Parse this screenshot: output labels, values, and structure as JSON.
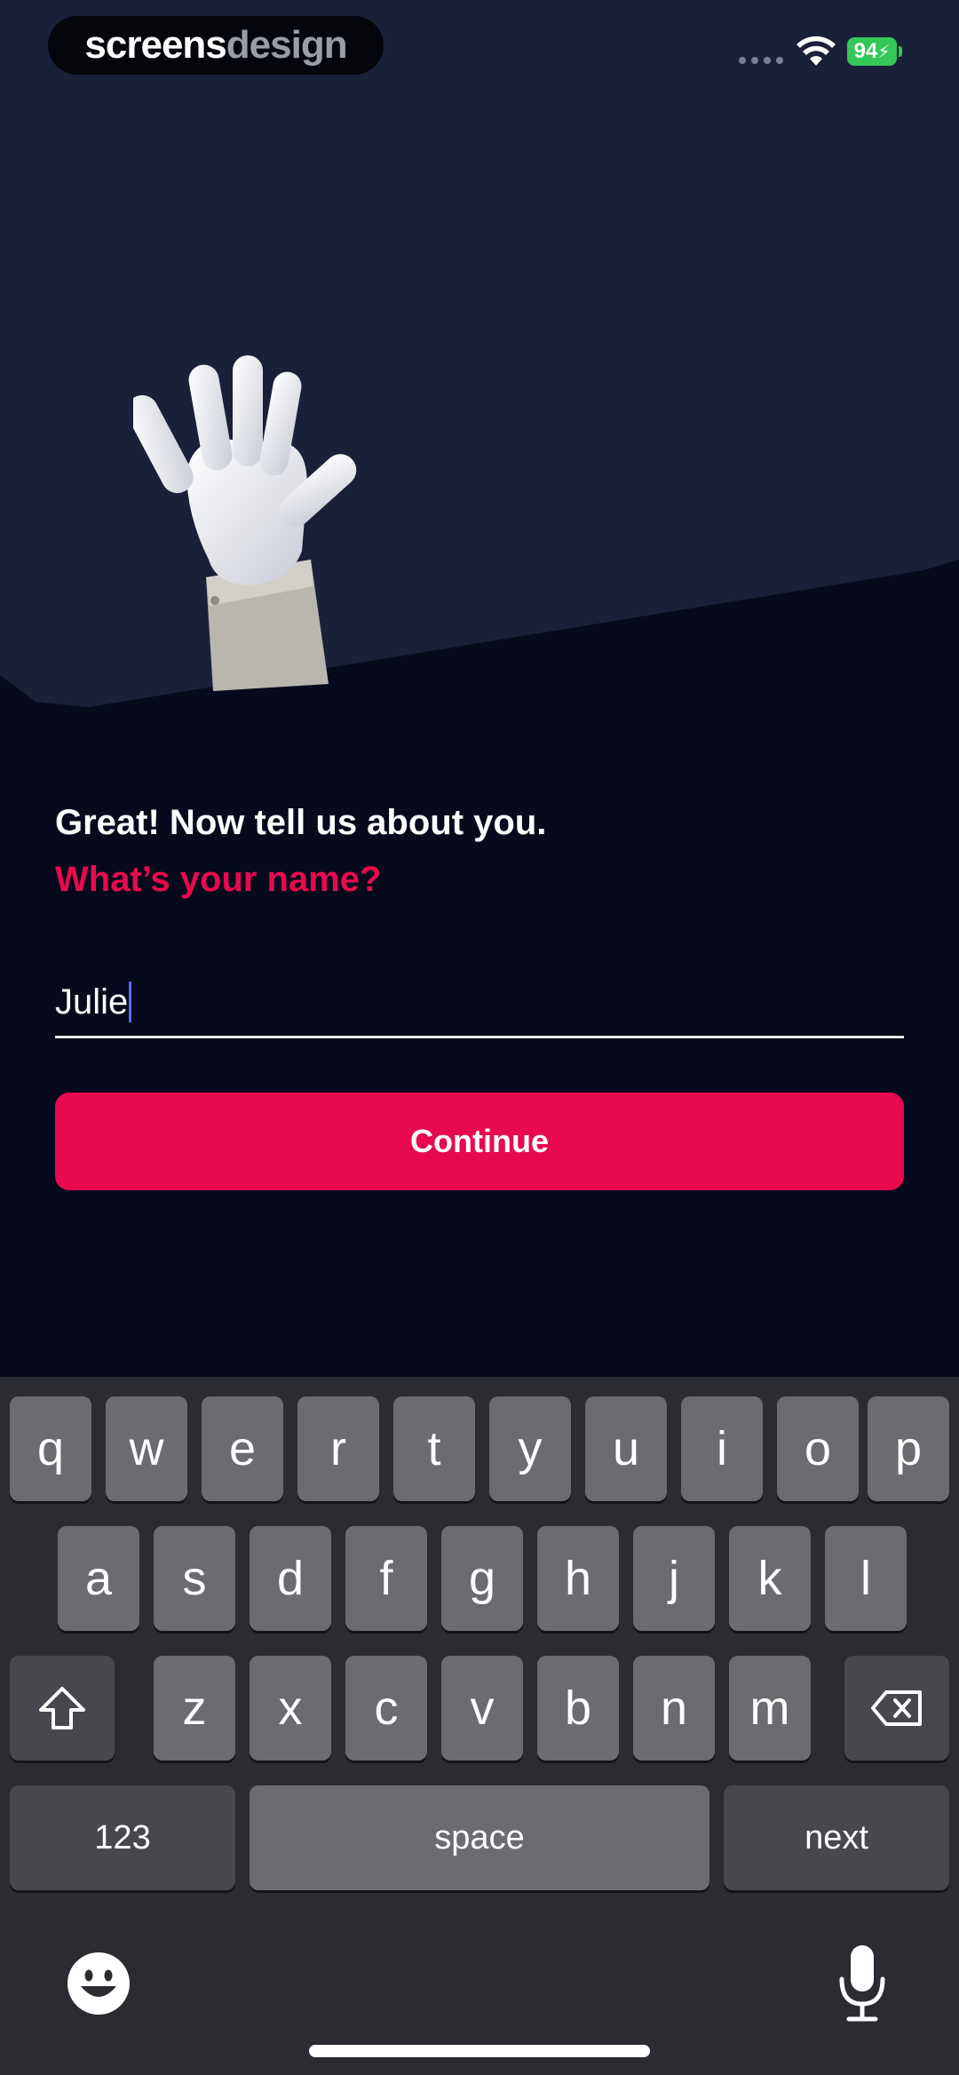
{
  "watermark": {
    "part1": "screens",
    "part2": "design"
  },
  "status_bar": {
    "battery": "94"
  },
  "onboarding": {
    "heading": "Great! Now tell us about you.",
    "subheading": "What’s your name?",
    "name_value": "Julie",
    "continue_label": "Continue"
  },
  "keyboard": {
    "row1": [
      "q",
      "w",
      "e",
      "r",
      "t",
      "y",
      "u",
      "i",
      "o",
      "p"
    ],
    "row2": [
      "a",
      "s",
      "d",
      "f",
      "g",
      "h",
      "j",
      "k",
      "l"
    ],
    "row3": [
      "z",
      "x",
      "c",
      "v",
      "b",
      "n",
      "m"
    ],
    "numbers_label": "123",
    "space_label": "space",
    "next_label": "next"
  },
  "colors": {
    "accent": "#e8094f",
    "background": "#060a1c",
    "panel": "#1a2038",
    "battery": "#34c759"
  }
}
